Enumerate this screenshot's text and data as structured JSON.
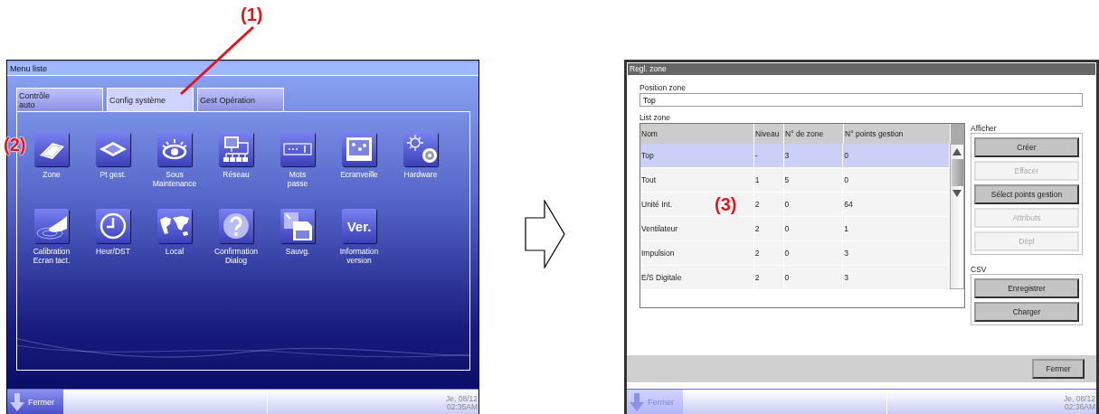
{
  "callouts": [
    {
      "label": "(1)"
    },
    {
      "label": "(2)"
    },
    {
      "label": "(3)"
    }
  ],
  "menu_screen": {
    "title": "Menu liste",
    "tabs": [
      {
        "label": "Contrôle\nauto",
        "selected": false
      },
      {
        "label": "Config système",
        "selected": true
      },
      {
        "label": "Gest Opération",
        "selected": false
      }
    ],
    "icons": [
      {
        "label": "Zone",
        "kind": "zone"
      },
      {
        "label": "Pt gest.",
        "kind": "cassette"
      },
      {
        "label": "Sous\nMaintenance",
        "kind": "eye"
      },
      {
        "label": "Réseau",
        "kind": "network"
      },
      {
        "label": "Mots\npasse",
        "kind": "password"
      },
      {
        "label": "Ecranveille",
        "kind": "screen"
      },
      {
        "label": "Hardware",
        "kind": "hardware"
      },
      {
        "label": "Calibration\nEcran tact.",
        "kind": "touch"
      },
      {
        "label": "Heur/DST",
        "kind": "clock"
      },
      {
        "label": "Local",
        "kind": "world"
      },
      {
        "label": "Confirmation\nDialog",
        "kind": "question"
      },
      {
        "label": "Sauvg.",
        "kind": "save"
      },
      {
        "label": "Information\nversion",
        "kind": "text",
        "glyph": "Ver."
      }
    ],
    "taskbar": {
      "button": "Fermer",
      "disabled": false,
      "date": "Je, 08/12",
      "time": "02:35AM"
    }
  },
  "zone_screen": {
    "title": "Regl. zone",
    "position_label": "Position zone",
    "position_value": "Top",
    "list_label": "List zone",
    "table": {
      "columns": [
        "Nom",
        "Niveau",
        "N° de zone",
        "N° points gestion"
      ],
      "rows": [
        {
          "cells": [
            "Top",
            "-",
            "3",
            "0"
          ],
          "selected": true
        },
        {
          "cells": [
            "Tout",
            "1",
            "5",
            "0"
          ],
          "selected": false
        },
        {
          "cells": [
            "Unité Int.",
            "2",
            "0",
            "64"
          ],
          "selected": false
        },
        {
          "cells": [
            "Ventilateur",
            "2",
            "0",
            "1"
          ],
          "selected": false
        },
        {
          "cells": [
            "Impulsion",
            "2",
            "0",
            "3"
          ],
          "selected": false
        },
        {
          "cells": [
            "E/S Digitale",
            "2",
            "0",
            "3"
          ],
          "selected": false
        }
      ]
    },
    "groups": [
      {
        "label": "Afficher",
        "buttons": [
          {
            "label": "Créer",
            "disabled": false
          },
          {
            "label": "Effacer",
            "disabled": true
          },
          {
            "label": "Sélect points gestion",
            "disabled": false
          },
          {
            "label": "Attributs",
            "disabled": true
          },
          {
            "label": "Dépl",
            "disabled": true
          }
        ]
      },
      {
        "label": "CSV",
        "buttons": [
          {
            "label": "Enregistrer",
            "disabled": false
          },
          {
            "label": "Charger",
            "disabled": false
          }
        ]
      }
    ],
    "close_button": "Fermer",
    "taskbar": {
      "button": "Fermer",
      "disabled": true,
      "date": "Je, 08/12",
      "time": "02:36AM"
    }
  }
}
